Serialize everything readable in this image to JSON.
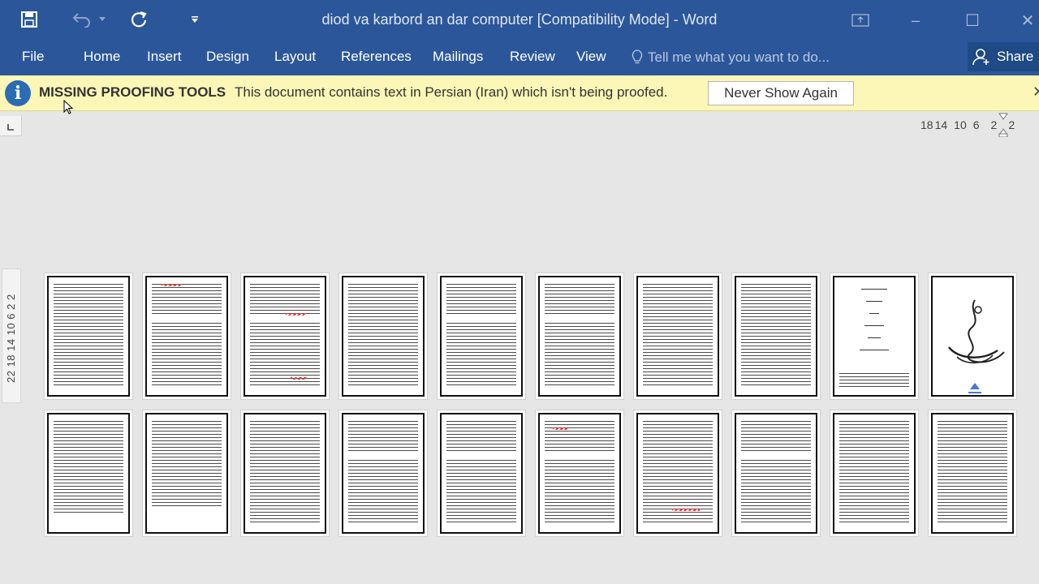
{
  "window": {
    "title": "diod va karbord an dar computer [Compatibility Mode] - Word"
  },
  "quick_access": {
    "save_icon": "save-icon",
    "undo_icon": "undo-icon",
    "redo_icon": "redo-icon",
    "customize_icon": "customize-qat-icon"
  },
  "window_controls": {
    "ribbon_display": "ribbon-display-icon",
    "minimize": "–",
    "maximize": "☐",
    "close": "✕"
  },
  "ribbon": {
    "tabs": [
      "File",
      "Home",
      "Insert",
      "Design",
      "Layout",
      "References",
      "Mailings",
      "Review",
      "View"
    ],
    "tell_me_placeholder": "Tell me what you want to do...",
    "share_label": "Share"
  },
  "infobar": {
    "title": "MISSING PROOFING TOOLS",
    "message": "This document contains text in Persian (Iran) which isn't being proofed.",
    "button_label": "Never Show Again",
    "close": "✕"
  },
  "rulers": {
    "horizontal": [
      "18",
      "14",
      "10",
      "6",
      "2",
      "2"
    ],
    "vertical": "22 18 14 10 6 2 2"
  },
  "colors": {
    "ribbon_blue": "#2b579a",
    "infobar_yellow": "#fcf7b6",
    "spelling_red": "#e33333"
  }
}
